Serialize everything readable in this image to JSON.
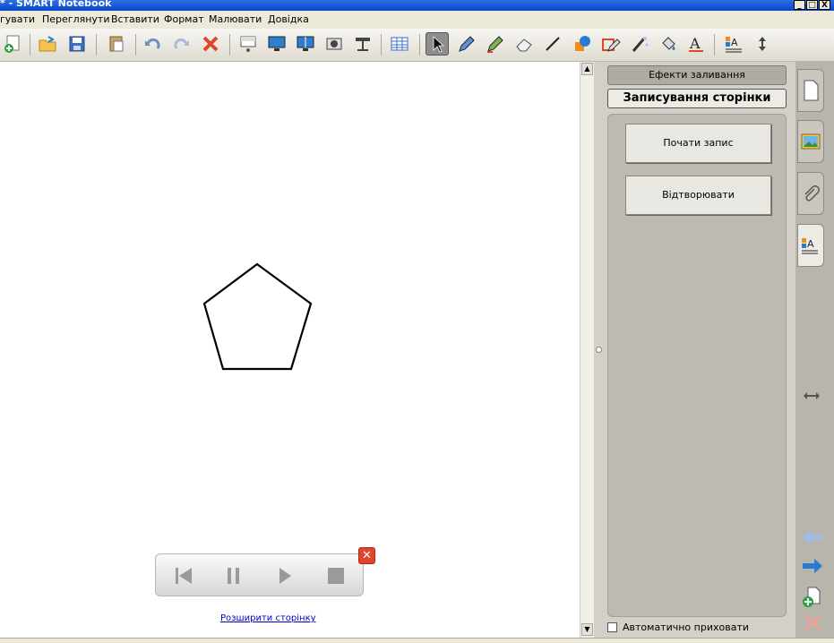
{
  "window": {
    "title": "* - SMART Notebook",
    "buttons": [
      "_",
      "□",
      "X"
    ]
  },
  "menu": {
    "items": [
      "гувати",
      "Переглянути",
      "Вставити",
      "Формат",
      "Малювати",
      "Довідка"
    ]
  },
  "toolbar": {
    "tools": [
      "new-page-icon",
      "open-folder-icon",
      "save-icon",
      "paste-icon",
      "undo-icon",
      "redo-icon",
      "delete-icon",
      "screen-shade-icon",
      "full-screen-icon",
      "dual-display-icon",
      "screen-capture-icon",
      "document-camera-icon",
      "table-icon",
      "select-icon",
      "pen-icon",
      "creative-pen-icon",
      "eraser-icon",
      "line-icon",
      "shapes-icon",
      "shape-recognition-pen-icon",
      "magic-pen-icon",
      "fill-icon",
      "text-icon",
      "properties-icon",
      "move-toolbar-icon"
    ],
    "active": "select-icon"
  },
  "side_panel": {
    "effects_label": "Ефекти заливання",
    "record_tab_label": "Записування сторінки",
    "start_record_label": "Почати запис",
    "play_label": "Відтворювати",
    "auto_hide_label": "Автоматично приховати",
    "auto_hide_checked": false
  },
  "side_tabs": [
    "page-sorter-icon",
    "gallery-icon",
    "attachments-icon",
    "properties-icon"
  ],
  "side_tabs_selected": "properties-icon",
  "nav_icons": [
    "resize-arrows-icon",
    "previous-page-icon",
    "next-page-icon",
    "add-page-icon",
    "delete-page-icon"
  ],
  "canvas": {
    "shape": "pentagon",
    "expand_link": "Розширити сторінку"
  },
  "player_controls": [
    "skip-back-icon",
    "pause-icon",
    "play-icon",
    "stop-icon"
  ],
  "colors": {
    "title_bar": "#0a47c8",
    "accent_close": "#e0462e",
    "link": "#0000cc"
  }
}
